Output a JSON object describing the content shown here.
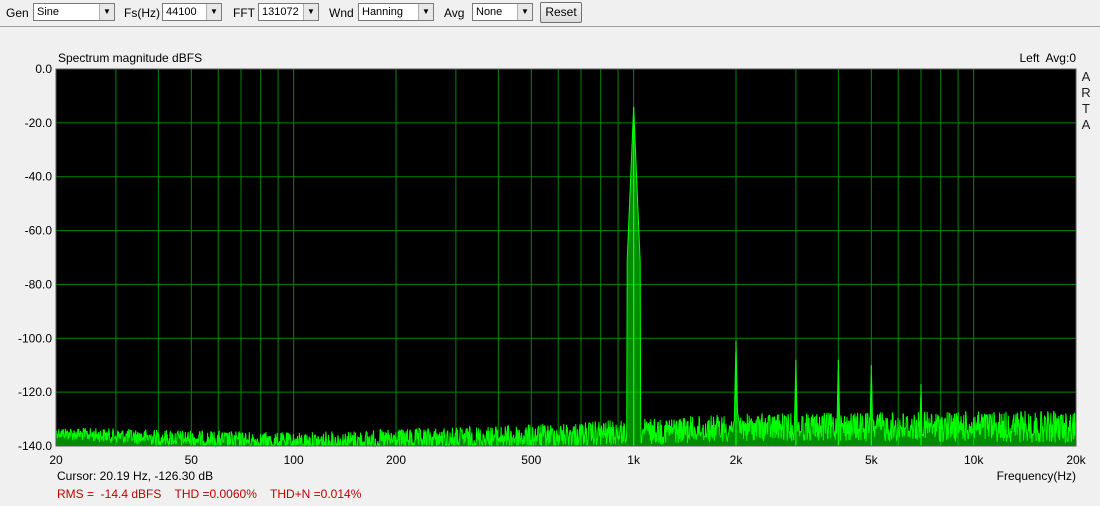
{
  "toolbar": {
    "gen": {
      "label": "Gen",
      "value": "Sine"
    },
    "fs": {
      "label": "Fs(Hz)",
      "value": "44100"
    },
    "fft": {
      "label": "FFT",
      "value": "131072"
    },
    "wnd": {
      "label": "Wnd",
      "value": "Hanning"
    },
    "avg": {
      "label": "Avg",
      "value": "None"
    },
    "reset_label": "Reset"
  },
  "plot": {
    "title": "Spectrum magnitude dBFS",
    "channel": "Left  Avg:0",
    "watermark": [
      "A",
      "R",
      "T",
      "A"
    ],
    "cursor": "Cursor: 20.19 Hz, -126.30 dB",
    "stats": "RMS =  -14.4 dBFS    THD =0.0060%    THD+N =0.014%",
    "xlabel": "Frequency(Hz)"
  },
  "colors": {
    "plot_bg": "#000000",
    "grid": "#008800",
    "trace": "#00ff00",
    "stats_text": "#c00000"
  },
  "chart_data": {
    "type": "line",
    "title": "Spectrum magnitude dBFS",
    "xlabel": "Frequency(Hz)",
    "ylabel": "",
    "x_scale": "log",
    "xlim": [
      20,
      20000
    ],
    "ylim": [
      -140,
      0
    ],
    "x_ticks": [
      {
        "value": 20,
        "label": "20"
      },
      {
        "value": 50,
        "label": "50"
      },
      {
        "value": 100,
        "label": "100"
      },
      {
        "value": 200,
        "label": "200"
      },
      {
        "value": 500,
        "label": "500"
      },
      {
        "value": 1000,
        "label": "1k"
      },
      {
        "value": 2000,
        "label": "2k"
      },
      {
        "value": 5000,
        "label": "5k"
      },
      {
        "value": 10000,
        "label": "10k"
      },
      {
        "value": 20000,
        "label": "20k"
      }
    ],
    "y_ticks": [
      {
        "value": 0,
        "label": "0.0"
      },
      {
        "value": -20,
        "label": "-20.0"
      },
      {
        "value": -40,
        "label": "-40.0"
      },
      {
        "value": -60,
        "label": "-60.0"
      },
      {
        "value": -80,
        "label": "-80.0"
      },
      {
        "value": -100,
        "label": "-100.0"
      },
      {
        "value": -120,
        "label": "-120.0"
      },
      {
        "value": -140,
        "label": "-140.0"
      }
    ],
    "grid": true,
    "x_grid_values": [
      20,
      30,
      40,
      50,
      60,
      70,
      80,
      90,
      100,
      200,
      300,
      400,
      500,
      600,
      700,
      800,
      900,
      1000,
      2000,
      3000,
      4000,
      5000,
      6000,
      7000,
      8000,
      9000,
      10000,
      20000
    ],
    "peaks": [
      {
        "freq": 1000,
        "db": -14
      },
      {
        "freq": 2000,
        "db": -101
      },
      {
        "freq": 3000,
        "db": -108
      },
      {
        "freq": 4000,
        "db": -108
      },
      {
        "freq": 5000,
        "db": -110
      },
      {
        "freq": 7000,
        "db": -117
      }
    ],
    "noise_floor_db": [
      {
        "freq": 20,
        "db": -133
      },
      {
        "freq": 100,
        "db": -135
      },
      {
        "freq": 500,
        "db": -132
      },
      {
        "freq": 1000,
        "db": -130
      },
      {
        "freq": 2000,
        "db": -128
      },
      {
        "freq": 10000,
        "db": -127
      },
      {
        "freq": 20000,
        "db": -127
      }
    ]
  }
}
